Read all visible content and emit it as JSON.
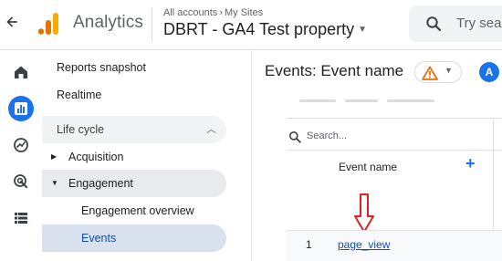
{
  "header": {
    "app_name": "Analytics",
    "breadcrumb": {
      "account": "All accounts",
      "separator": "›",
      "site": "My Sites"
    },
    "property_name": "DBRT - GA4 Test property",
    "search_placeholder": "Try sear"
  },
  "rail": {
    "icons": [
      "home-icon",
      "reports-icon",
      "explore-icon",
      "advertising-icon",
      "configure-icon"
    ],
    "active": "reports-icon",
    "accent": "#1a73e8"
  },
  "nav": {
    "top_items": [
      {
        "label": "Reports snapshot"
      },
      {
        "label": "Realtime"
      }
    ],
    "section": {
      "label": "Life cycle",
      "expanded": true
    },
    "groups": [
      {
        "label": "Acquisition",
        "expanded": false
      },
      {
        "label": "Engagement",
        "expanded": true
      }
    ],
    "sub_items": [
      {
        "label": "Engagement overview",
        "selected": false
      },
      {
        "label": "Events",
        "selected": true
      }
    ]
  },
  "main": {
    "title": "Events: Event name",
    "avatar_letter": "A",
    "table": {
      "search_placeholder": "Search...",
      "column_header": "Event name",
      "rows": [
        {
          "index": "1",
          "event_name": "page_view"
        }
      ]
    }
  },
  "colors": {
    "accent": "#1a73e8",
    "annotation_arrow": "#e02020",
    "warning": "#e8710a",
    "selected_nav": "#d9e1ef"
  }
}
